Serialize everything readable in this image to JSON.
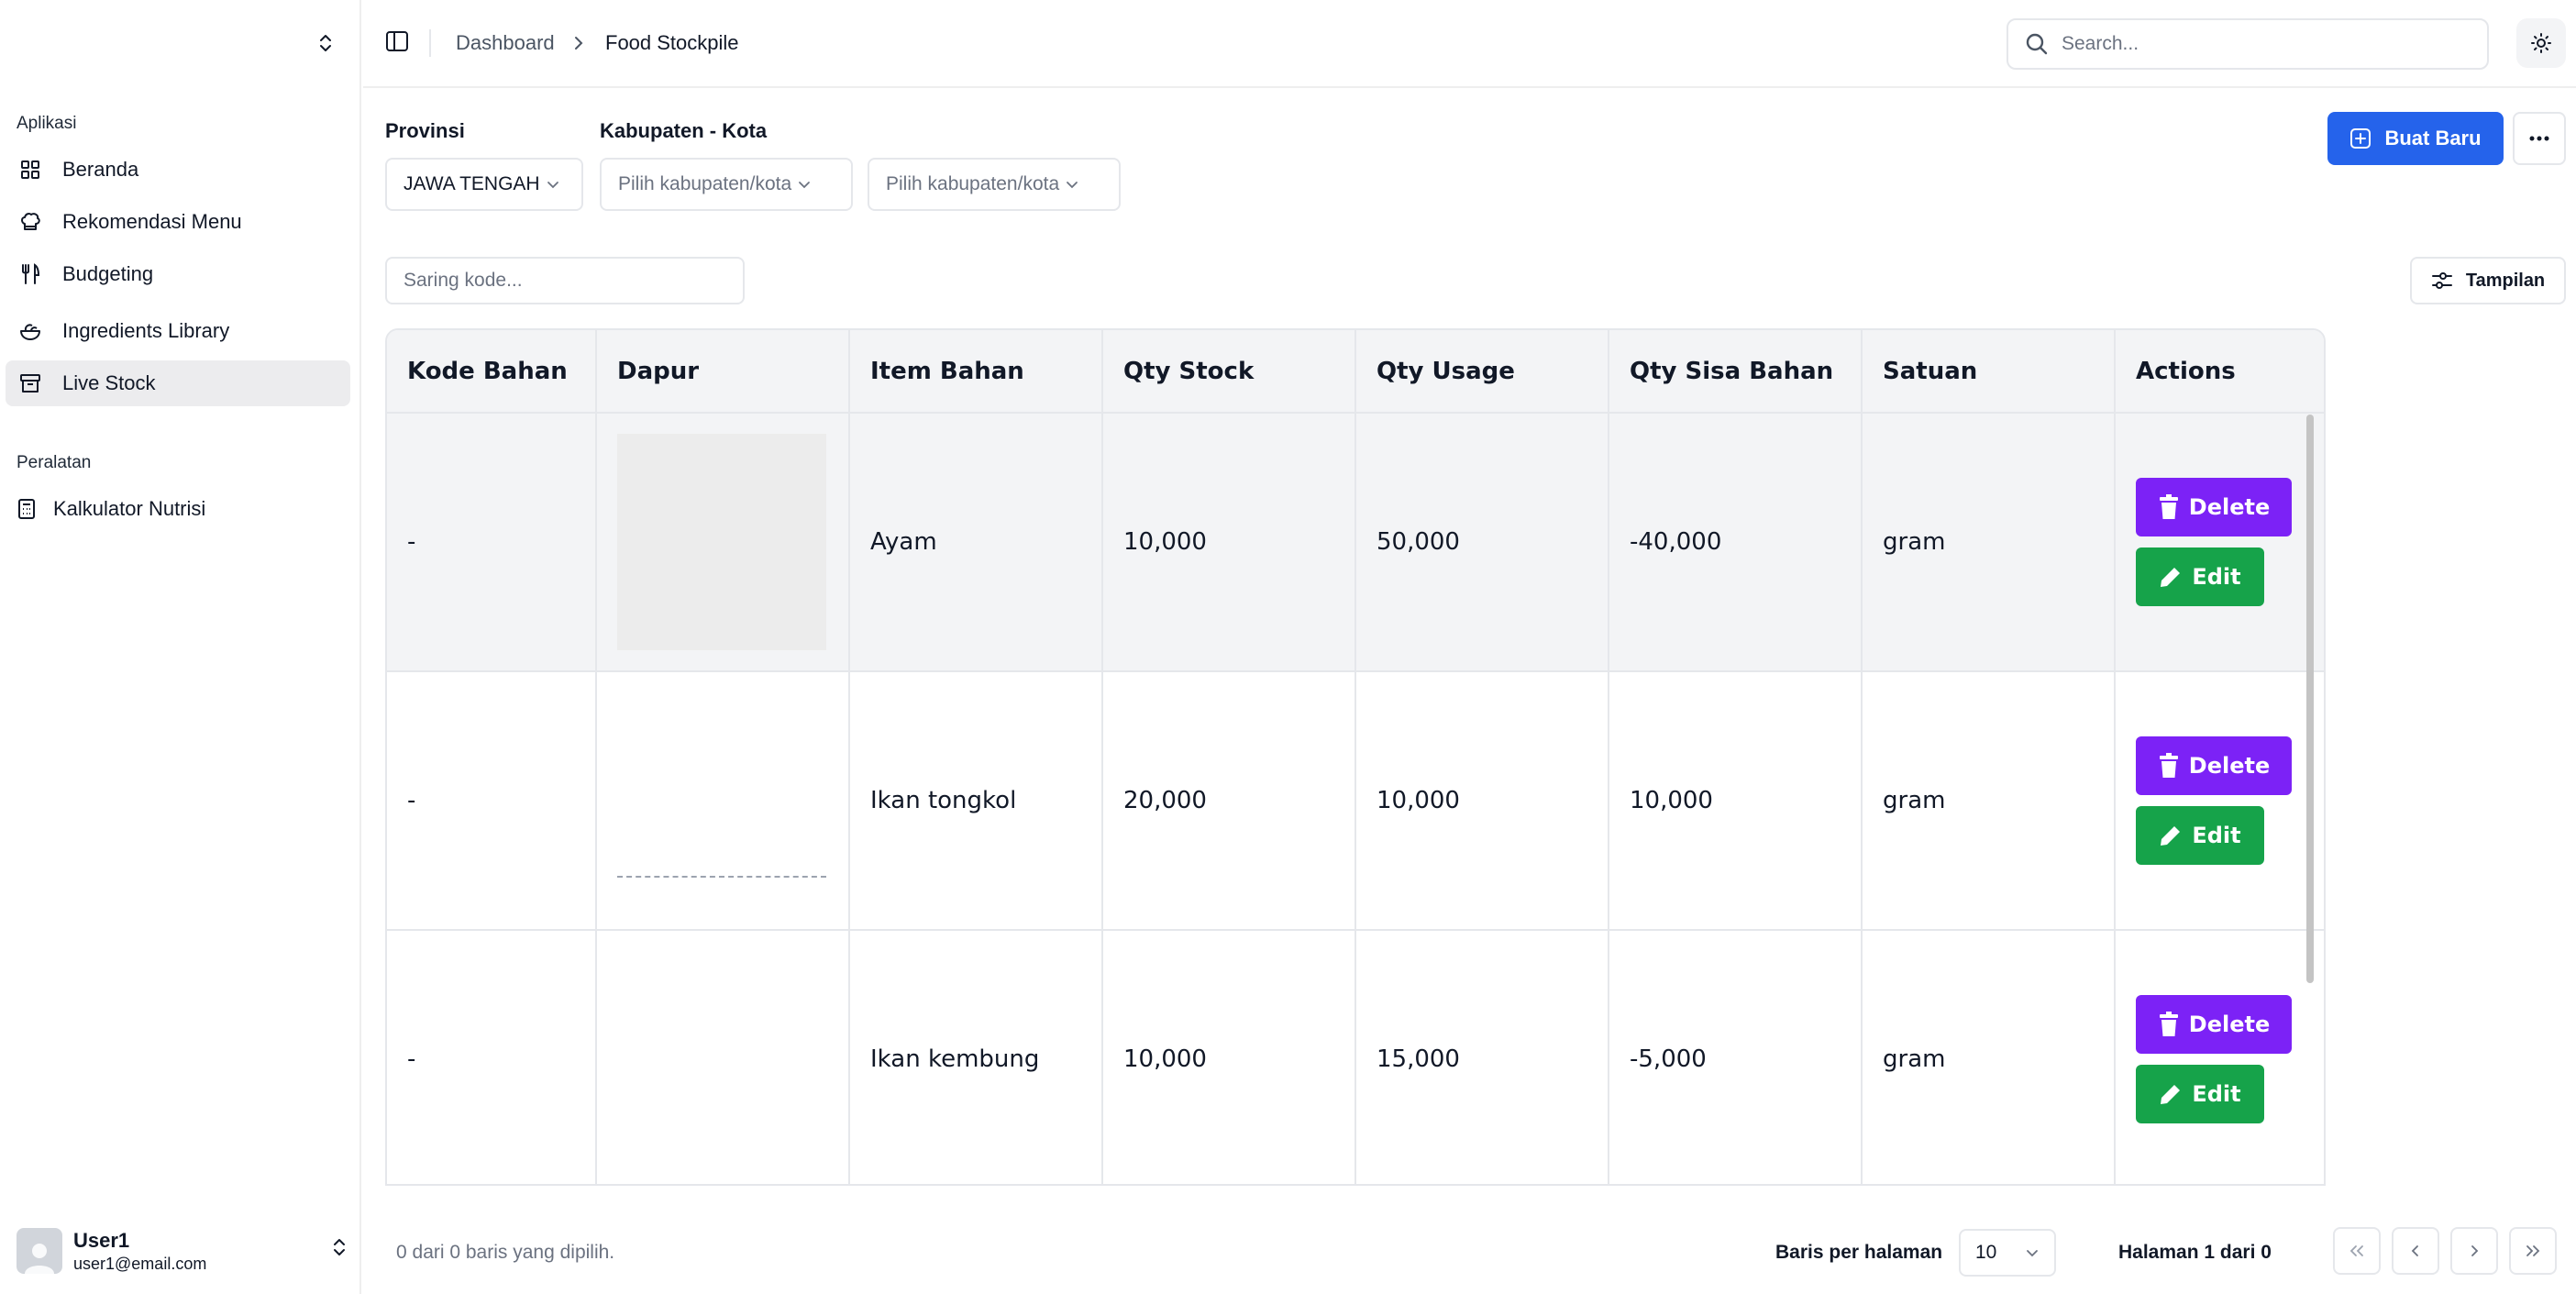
{
  "sidebar": {
    "sections": [
      {
        "title": "Aplikasi",
        "items": [
          {
            "label": "Beranda",
            "icon": "grid-icon"
          },
          {
            "label": "Rekomendasi Menu",
            "icon": "chef-hat-icon"
          },
          {
            "label": "Budgeting",
            "icon": "utensils-icon"
          },
          {
            "label": "Ingredients Library",
            "icon": "salad-icon"
          },
          {
            "label": "Live Stock",
            "icon": "archive-icon",
            "active": true
          }
        ]
      },
      {
        "title": "Peralatan",
        "items": [
          {
            "label": "Kalkulator Nutrisi",
            "icon": "calculator-icon"
          }
        ]
      }
    ],
    "user": {
      "name": "User1",
      "email": "user1@email.com"
    }
  },
  "header": {
    "breadcrumb": [
      "Dashboard",
      "Food Stockpile"
    ],
    "search_placeholder": "Search..."
  },
  "filters": {
    "provinsi_label": "Provinsi",
    "provinsi_value": "JAWA TENGAH",
    "kabupaten_label": "Kabupaten - Kota",
    "kabupaten_placeholder": "Pilih kabupaten/kota",
    "kabupaten2_placeholder": "Pilih kabupaten/kota",
    "new_button": "Buat Baru",
    "code_filter_placeholder": "Saring kode...",
    "view_button": "Tampilan"
  },
  "table": {
    "columns": [
      "Kode Bahan",
      "Dapur",
      "Item Bahan",
      "Qty Stock",
      "Qty Usage",
      "Qty Sisa Bahan",
      "Satuan",
      "Actions"
    ],
    "rows": [
      {
        "kode": "-",
        "item": "Ayam",
        "stock": "10,000",
        "usage": "50,000",
        "sisa": "-40,000",
        "satuan": "gram"
      },
      {
        "kode": "-",
        "item": "Ikan tongkol",
        "stock": "20,000",
        "usage": "10,000",
        "sisa": "10,000",
        "satuan": "gram"
      },
      {
        "kode": "-",
        "item": "Ikan kembung",
        "stock": "10,000",
        "usage": "15,000",
        "sisa": "-5,000",
        "satuan": "gram"
      }
    ],
    "delete_label": "Delete",
    "edit_label": "Edit"
  },
  "footer": {
    "selection_info": "0 dari 0 baris yang dipilih.",
    "rows_per_page_label": "Baris per halaman",
    "rows_per_page_value": "10",
    "page_info": "Halaman 1 dari 0"
  },
  "colors": {
    "primary": "#2563eb",
    "delete": "#7c22f6",
    "edit": "#16a34a",
    "active_nav": "#ececee",
    "header_bg": "#f3f4f6"
  }
}
